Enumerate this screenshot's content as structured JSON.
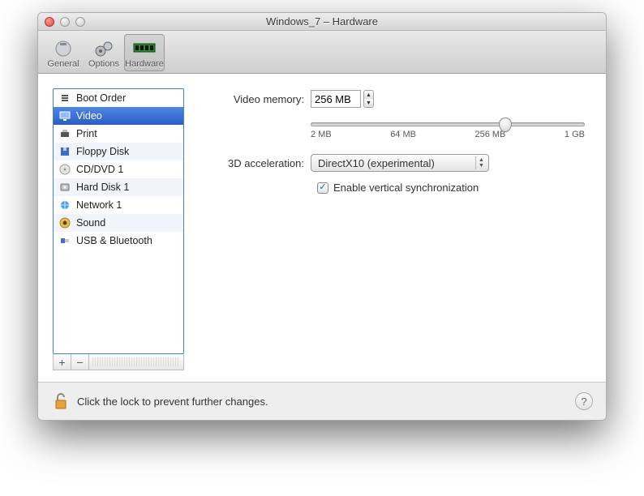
{
  "title": "Windows_7 – Hardware",
  "toolbar": {
    "general": "General",
    "options": "Options",
    "hardware": "Hardware"
  },
  "sidebar": {
    "items": [
      {
        "label": "Boot Order"
      },
      {
        "label": "Video"
      },
      {
        "label": "Print"
      },
      {
        "label": "Floppy Disk"
      },
      {
        "label": "CD/DVD 1"
      },
      {
        "label": "Hard Disk 1"
      },
      {
        "label": "Network 1"
      },
      {
        "label": "Sound"
      },
      {
        "label": "USB & Bluetooth"
      }
    ],
    "selected_index": 1
  },
  "settings": {
    "video_memory_label": "Video memory:",
    "video_memory_value": "256 MB",
    "slider": {
      "min_label": "2 MB",
      "t1": "64 MB",
      "t2": "256 MB",
      "max_label": "1 GB",
      "knob_percent": 71
    },
    "accel_label": "3D acceleration:",
    "accel_value": "DirectX10 (experimental)",
    "vsync_label": "Enable vertical synchronization",
    "vsync_checked": true
  },
  "footer": {
    "lock_text": "Click the lock to prevent further changes."
  }
}
